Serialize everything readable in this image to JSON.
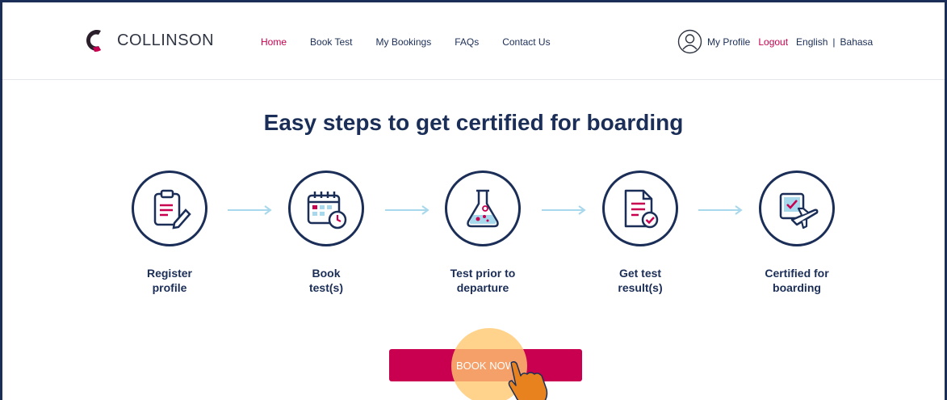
{
  "header": {
    "logo_text": "COLLINSON",
    "nav": [
      {
        "label": "Home",
        "active": true
      },
      {
        "label": "Book Test",
        "active": false
      },
      {
        "label": "My Bookings",
        "active": false
      },
      {
        "label": "FAQs",
        "active": false
      },
      {
        "label": "Contact Us",
        "active": false
      }
    ],
    "profile_label": "My Profile",
    "logout_label": "Logout",
    "lang_english": "English",
    "lang_separator": "|",
    "lang_bahasa": "Bahasa"
  },
  "main": {
    "title": "Easy steps to get certified for boarding",
    "steps": [
      {
        "line1": "Register",
        "line2": "profile",
        "icon": "clipboard-pencil-icon"
      },
      {
        "line1": "Book",
        "line2": "test(s)",
        "icon": "calendar-clock-icon"
      },
      {
        "line1": "Test prior to",
        "line2": "departure",
        "icon": "lab-flask-icon"
      },
      {
        "line1": "Get test",
        "line2": "result(s)",
        "icon": "document-check-icon"
      },
      {
        "line1": "Certified for",
        "line2": "boarding",
        "icon": "certificate-plane-icon"
      }
    ],
    "book_button_label": "BOOK NOW"
  },
  "colors": {
    "navy": "#1b2e57",
    "brand_crimson": "#c8004f",
    "arrow_blue": "#a8d8ec",
    "click_highlight": "#ffc86e",
    "cursor_orange": "#e8821e"
  }
}
